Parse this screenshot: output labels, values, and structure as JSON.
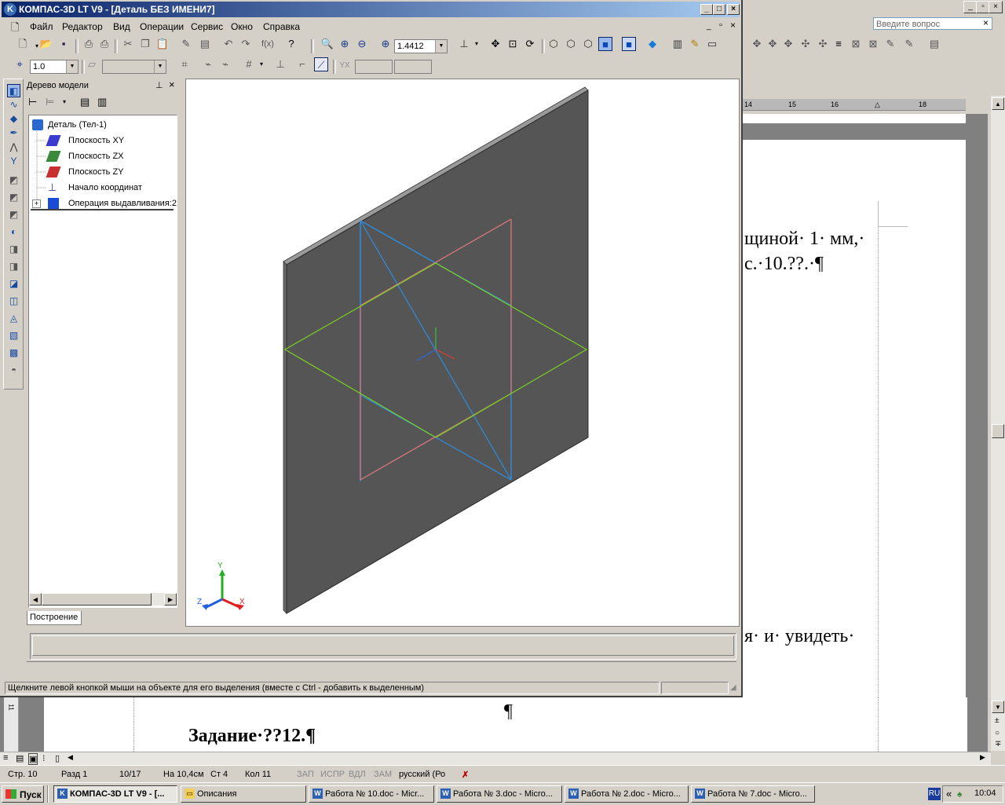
{
  "kompas": {
    "title": "КОМПАС-3D LT V9 - [Деталь БЕЗ ИМЕНИ7]",
    "window_buttons": [
      "_",
      "□",
      "×"
    ],
    "doc_buttons": [
      "_",
      "▫",
      "×"
    ],
    "menu": [
      "Файл",
      "Редактор",
      "Вид",
      "Операции",
      "Сервис",
      "Окно",
      "Справка"
    ],
    "toolbar": {
      "zoom_value": "1.4412",
      "step_value": "1.0"
    },
    "model_tree": {
      "title": "Дерево модели",
      "root": "Деталь (Тел-1)",
      "items": [
        "Плоскость XY",
        "Плоскость ZX",
        "Плоскость ZY",
        "Начало координат",
        "Операция выдавливания:2"
      ],
      "tab": "Построение"
    },
    "axes": {
      "x": "X",
      "y": "Y",
      "z": "Z"
    },
    "status_text": "Щелкните левой кнопкой мыши на объекте для его выделения (вместе с Ctrl - добавить к выделенным)"
  },
  "word": {
    "ask_placeholder": "Введите вопрос",
    "ruler_marks": [
      "14",
      "15",
      "16",
      "18"
    ],
    "doc_lines": {
      "line1": "щиной· 1· мм,·",
      "line2": "с.·10.??.·¶",
      "line3": "я·  и·  увидеть·",
      "pilcrow": "¶",
      "task": "Задание·??12.¶"
    },
    "vruler_mark": "11",
    "status": {
      "page": "Стр. 10",
      "section": "Разд 1",
      "pages": "10/17",
      "at": "На 10,4см",
      "line": "Ст 4",
      "col": "Кол 11",
      "rec": "ЗАП",
      "trk": "ИСПР",
      "ext": "ВДЛ",
      "ovr": "ЗАМ",
      "lang": "русский (Ро"
    }
  },
  "taskbar": {
    "start": "Пуск",
    "tasks": [
      "КОМПАС-3D LT V9 - [...",
      "Описания",
      "Работа № 10.doc - Micr...",
      "Работа № 3.doc - Micro...",
      "Работа № 2.doc - Micro...",
      "Работа № 7.doc - Micro..."
    ],
    "lang": "RU",
    "chevrons": "«",
    "clock": "10:04"
  }
}
